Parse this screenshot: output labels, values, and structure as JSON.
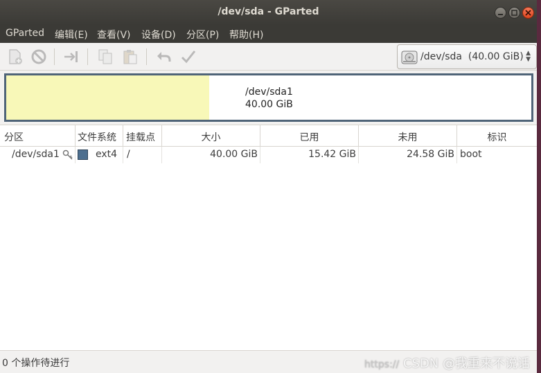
{
  "window": {
    "title": "/dev/sda - GParted"
  },
  "menubar": {
    "items": [
      "GParted",
      "编辑(E)",
      "查看(V)",
      "设备(D)",
      "分区(P)",
      "帮助(H)"
    ]
  },
  "toolbar": {
    "icons": [
      "new-partition-icon",
      "delete-icon",
      "resize-move-icon",
      "copy-icon",
      "paste-icon",
      "undo-icon",
      "apply-icon"
    ],
    "device": {
      "path": "/dev/sda",
      "size": "(40.00 GiB)"
    }
  },
  "diskmap": {
    "partition": "/dev/sda1",
    "size": "40.00 GiB",
    "used_fraction": 0.386,
    "used_color": "#f8f8b8",
    "border_color": "#4f6478"
  },
  "table": {
    "headers": [
      "分区",
      "文件系统",
      "挂载点",
      "大小",
      "已用",
      "未用",
      "标识"
    ],
    "rows": [
      {
        "partition": "/dev/sda1",
        "filesystem": "ext4",
        "mountpoint": "/",
        "size": "40.00 GiB",
        "used": "15.42 GiB",
        "unused": "24.58 GiB",
        "flags": "boot",
        "fs_color": "#4e6f8f"
      }
    ]
  },
  "statusbar": {
    "text": "0 个操作待进行"
  },
  "watermark": {
    "url": "https://",
    "text": "CSDN @我重来不说话"
  }
}
